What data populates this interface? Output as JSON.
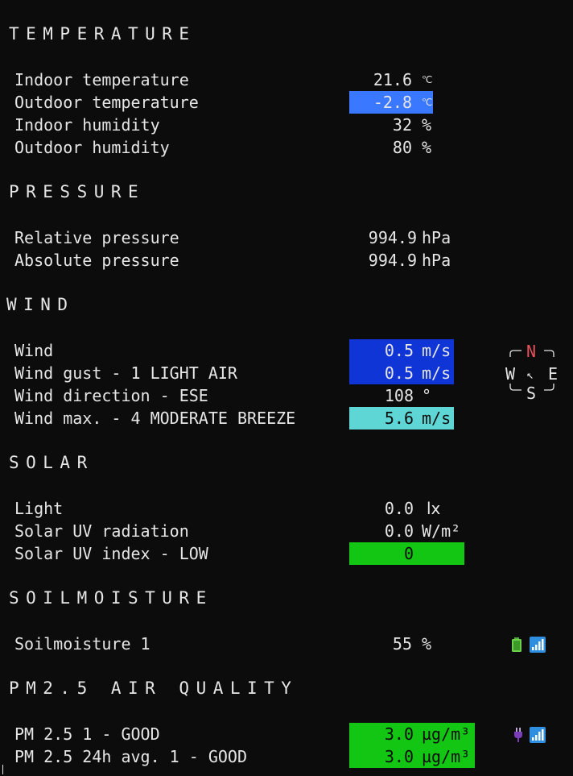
{
  "colors": {
    "background": "#0c0c0c",
    "text": "#e6e6e6",
    "blue_light": "#3a78ff",
    "blue_dark": "#0f35d6",
    "cyan": "#5fd6d6",
    "green": "#13c613",
    "north_red": "#e8505b"
  },
  "temperature": {
    "heading": "TEMPERATURE",
    "rows": [
      {
        "label": "Indoor temperature",
        "value": "21.6",
        "unit": "℃"
      },
      {
        "label": "Outdoor temperature",
        "value": "-2.8",
        "unit": "℃"
      },
      {
        "label": "Indoor humidity",
        "value": "32",
        "unit": "%"
      },
      {
        "label": "Outdoor humidity",
        "value": "80",
        "unit": "%"
      }
    ]
  },
  "pressure": {
    "heading": "PRESSURE",
    "rows": [
      {
        "label": "Relative pressure",
        "value": "994.9",
        "unit": "hPa"
      },
      {
        "label": "Absolute pressure",
        "value": "994.9",
        "unit": "hPa"
      }
    ]
  },
  "wind": {
    "heading": "WIND",
    "rows": [
      {
        "label": "Wind",
        "value": "0.5",
        "unit": "m/s"
      },
      {
        "label": "Wind gust - 1 LIGHT AIR",
        "value": "0.5",
        "unit": "m/s"
      },
      {
        "label": "Wind direction - ESE",
        "value": "108",
        "unit": "°"
      },
      {
        "label": "Wind max. - 4 MODERATE BREEZE",
        "value": "5.6",
        "unit": "m/s"
      }
    ],
    "compass": {
      "n": "N",
      "s": "S",
      "e": "E",
      "w": "W",
      "arrow": "↖"
    }
  },
  "solar": {
    "heading": "SOLAR",
    "rows": [
      {
        "label": "Light",
        "value": "0.0",
        "unit": "lx"
      },
      {
        "label": "Solar UV radiation",
        "value": "0.0",
        "unit": "W/m²"
      },
      {
        "label": "Solar UV index - LOW",
        "value": "0",
        "unit": ""
      }
    ]
  },
  "soil": {
    "heading": "SOILMOISTURE",
    "rows": [
      {
        "label": "Soilmoisture 1",
        "value": "55",
        "unit": "%"
      }
    ],
    "icons": [
      "battery-icon",
      "signal-icon"
    ]
  },
  "pm25": {
    "heading": "PM2.5 AIR QUALITY",
    "rows": [
      {
        "label": "PM 2.5 1 - GOOD",
        "value": "3.0",
        "unit": "µg/m³"
      },
      {
        "label": "PM 2.5 24h avg. 1 - GOOD",
        "value": "3.0",
        "unit": "µg/m³"
      }
    ],
    "icons": [
      "plug-icon",
      "signal-icon"
    ]
  }
}
